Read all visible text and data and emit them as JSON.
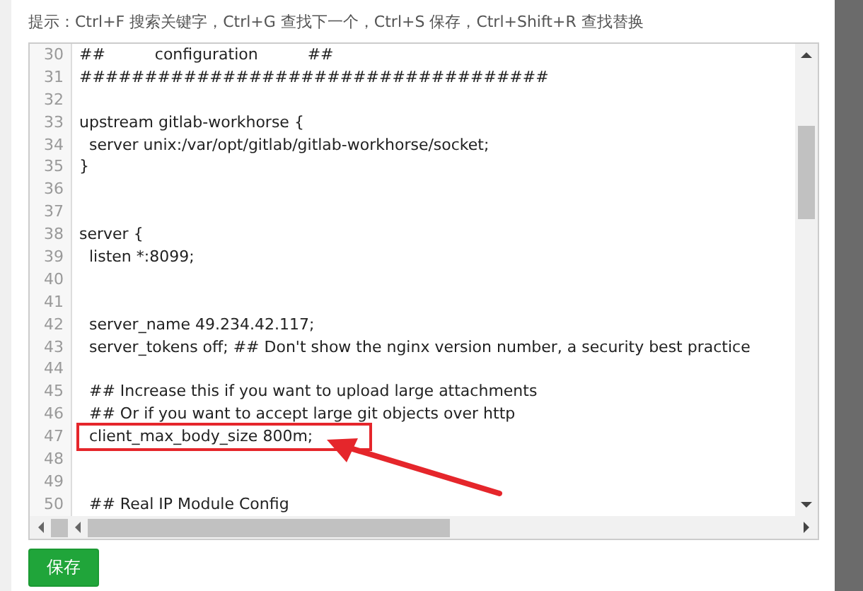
{
  "hint": "提示：Ctrl+F 搜索关键字，Ctrl+G 查找下一个，Ctrl+S 保存，Ctrl+Shift+R 查找替换",
  "editor": {
    "lines": [
      {
        "number": "30",
        "text": "##          configuration          ##",
        "highlighted": false
      },
      {
        "number": "31",
        "text": "####################################",
        "highlighted": false
      },
      {
        "number": "32"
      },
      {
        "number": "33",
        "text": "upstream gitlab-workhorse {",
        "highlighted": false
      },
      {
        "number": "34",
        "text": "  server unix:/var/opt/gitlab/gitlab-workhorse/socket;",
        "highlighted": false
      },
      {
        "number": "35",
        "text": "}",
        "highlighted": false
      },
      {
        "number": "36"
      },
      {
        "number": "37"
      },
      {
        "number": "38",
        "text": "server {",
        "highlighted": false
      },
      {
        "number": "39",
        "text": "  listen *:8099;",
        "highlighted": false
      },
      {
        "number": "40"
      },
      {
        "number": "41"
      },
      {
        "number": "42",
        "text": "  server_name 49.234.42.117;",
        "highlighted": false
      },
      {
        "number": "43",
        "text": "  server_tokens off; ## Don't show the nginx version number, a security best practice",
        "highlighted": false
      },
      {
        "number": "44"
      },
      {
        "number": "45",
        "text": "  ## Increase this if you want to upload large attachments",
        "highlighted": false
      },
      {
        "number": "46",
        "text": "  ## Or if you want to accept large git objects over http",
        "highlighted": false
      },
      {
        "number": "47",
        "text": "  client_max_body_size 800m;",
        "highlighted": true
      },
      {
        "number": "48"
      },
      {
        "number": "49"
      },
      {
        "number": "50",
        "text": "  ## Real IP Module Config",
        "highlighted": false
      }
    ]
  },
  "save_button": "保存"
}
